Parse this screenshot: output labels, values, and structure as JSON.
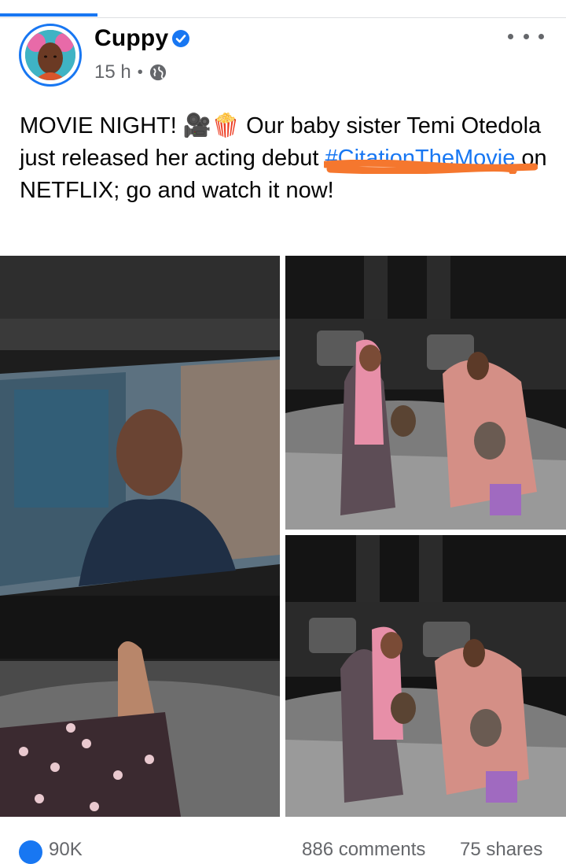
{
  "post": {
    "author": "Cuppy",
    "time": "15 h",
    "separator": "•",
    "text_before": "MOVIE NIGHT! 🎥🍿 Our baby sister Temi Otedola just released her acting debut ",
    "hashtag": "#CitationTheMovie",
    "text_after": " on NETFLIX; go and watch it now!"
  },
  "stats": {
    "reactions": "90K",
    "comments": "886 comments",
    "shares": "75 shares"
  },
  "colors": {
    "accent": "#1877f2",
    "meta": "#65676b",
    "redaction": "#f5772e"
  },
  "icons": {
    "verified": "verified-badge-icon",
    "audience": "globe-icon",
    "more": "more-options-icon",
    "like": "like-reaction-icon"
  }
}
